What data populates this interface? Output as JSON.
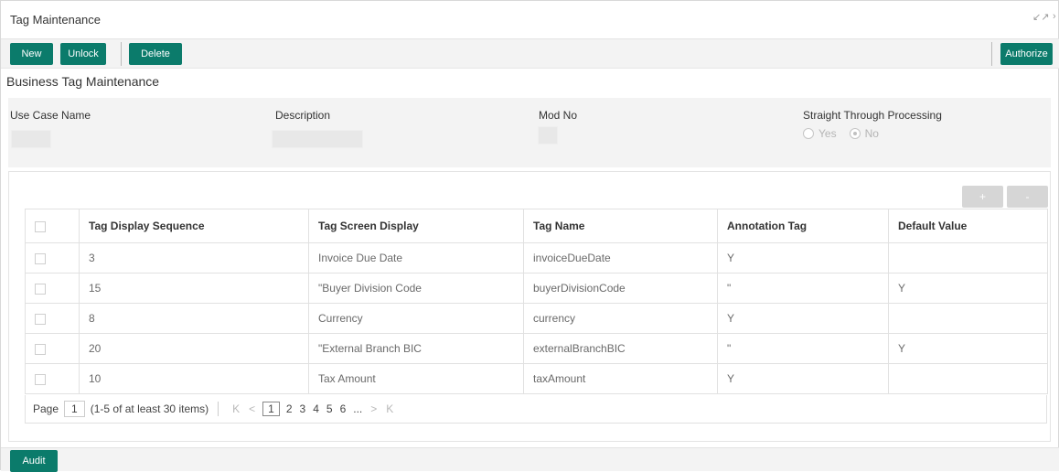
{
  "window": {
    "title": "Tag Maintenance",
    "controls": [
      "↙↗",
      "›"
    ]
  },
  "toolbar": {
    "new_label": "New",
    "unlock_label": "Unlock",
    "delete_label": "Delete",
    "authorize_label": "Authorize"
  },
  "section_title": "Business Tag Maintenance",
  "form": {
    "use_case_label": "Use Case Name",
    "use_case_value": "",
    "description_label": "Description",
    "description_value": "",
    "mod_no_label": "Mod No",
    "mod_no_value": "",
    "stp_label": "Straight Through Processing",
    "stp_options": [
      "Yes",
      "No"
    ],
    "stp_selected": "No"
  },
  "grid": {
    "add_label": "+",
    "remove_label": "-",
    "columns": [
      "Tag Display Sequence",
      "Tag Screen Display",
      "Tag Name",
      "Annotation Tag",
      "Default Value"
    ],
    "rows": [
      [
        "3",
        "Invoice Due Date",
        "invoiceDueDate",
        "Y",
        ""
      ],
      [
        "15",
        "\"Buyer Division Code",
        "buyerDivisionCode",
        "\"",
        "Y"
      ],
      [
        "8",
        "Currency",
        "currency",
        "Y",
        ""
      ],
      [
        "20",
        "\"External Branch BIC",
        "externalBranchBIC",
        "\"",
        "Y"
      ],
      [
        "10",
        "Tax Amount",
        "taxAmount",
        "Y",
        ""
      ]
    ]
  },
  "pager": {
    "page_label": "Page",
    "current_page": "1",
    "summary": "(1-5 of at least 30 items)",
    "first": "K",
    "prev": "<",
    "pages": [
      "1",
      "2",
      "3",
      "4",
      "5",
      "6",
      "..."
    ],
    "next": ">",
    "last": "K"
  },
  "footer": {
    "audit_label": "Audit"
  },
  "colors": {
    "accent": "#0b7b6b",
    "panel": "#f3f3f3"
  }
}
